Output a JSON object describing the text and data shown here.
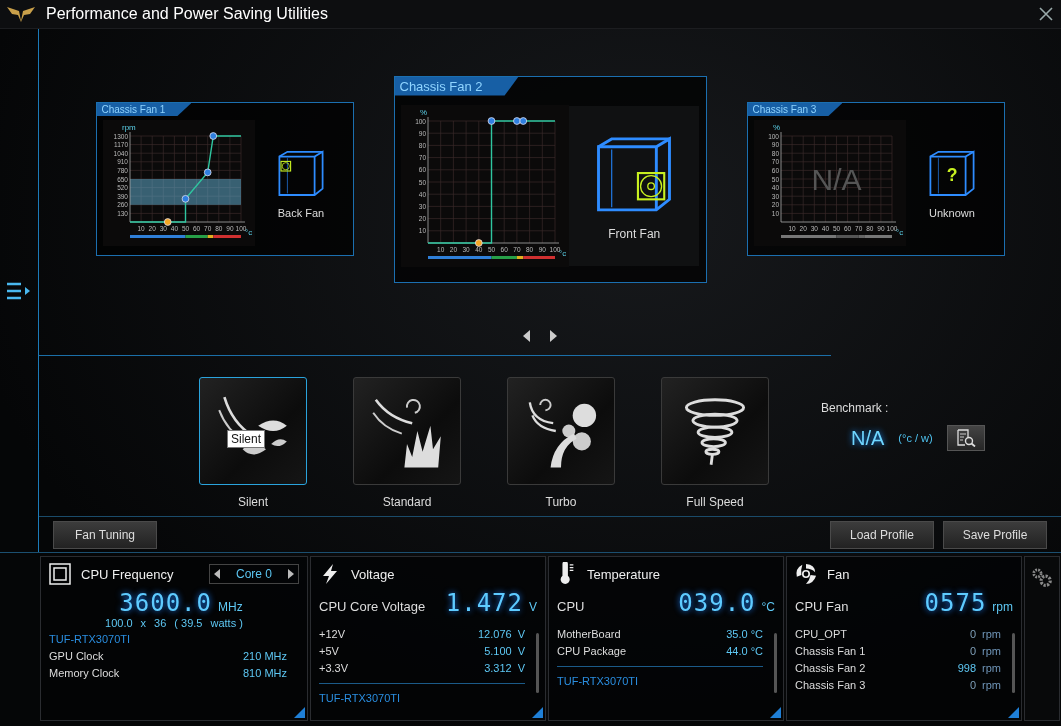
{
  "window": {
    "title": "Performance and Power Saving Utilities"
  },
  "fan_cards": [
    {
      "title": "Chassis Fan 1",
      "selected": false,
      "kind": "back",
      "label": "Back Fan",
      "chart_data": {
        "type": "line",
        "ylabel": "rpm",
        "xlabel": "°c",
        "grid": true,
        "xlim": [
          0,
          100
        ],
        "ylim": [
          0,
          1300
        ],
        "xticks": [
          10,
          20,
          30,
          40,
          50,
          60,
          70,
          80,
          90,
          100
        ],
        "yticks": [
          130,
          260,
          390,
          520,
          650,
          780,
          910,
          1040,
          1170,
          1300
        ],
        "x": [
          0,
          34,
          50,
          50,
          70,
          75,
          100
        ],
        "bands": [
          {
            "axis": "y",
            "from": 260,
            "to": 650
          }
        ],
        "series": [
          {
            "color": "#2fc6a0",
            "values": [
              0,
              0,
              0,
              350,
              750,
              1300,
              1300
            ]
          },
          {
            "type": "scatter",
            "color": "#f5a623",
            "values": [
              null,
              0,
              null,
              null,
              null,
              null,
              null
            ]
          },
          {
            "type": "scatter",
            "color": "#2f7fe0",
            "values": [
              null,
              null,
              null,
              350,
              750,
              1300,
              null
            ]
          }
        ]
      }
    },
    {
      "title": "Chassis Fan 2",
      "selected": true,
      "kind": "front",
      "label": "Front Fan",
      "chart_data": {
        "type": "line",
        "ylabel": "%",
        "xlabel": "°c",
        "grid": true,
        "xlim": [
          0,
          100
        ],
        "ylim": [
          0,
          100
        ],
        "xticks": [
          10,
          20,
          30,
          40,
          50,
          60,
          70,
          80,
          90,
          100
        ],
        "yticks": [
          10,
          20,
          30,
          40,
          50,
          60,
          70,
          80,
          90,
          100
        ],
        "x": [
          0,
          40,
          50,
          50,
          70,
          75,
          100
        ],
        "series": [
          {
            "color": "#2fc6a0",
            "values": [
              0,
              0,
              0,
              100,
              100,
              100,
              100
            ]
          },
          {
            "type": "scatter",
            "color": "#f5a623",
            "values": [
              null,
              0,
              null,
              null,
              null,
              null,
              null
            ]
          },
          {
            "type": "scatter",
            "color": "#2f7fe0",
            "values": [
              null,
              null,
              null,
              100,
              100,
              100,
              null
            ]
          }
        ]
      }
    },
    {
      "title": "Chassis Fan 3",
      "selected": false,
      "kind": "unknown",
      "case_mark": "?",
      "overlay_text": "N/A",
      "label": "Unknown",
      "chart_data": {
        "type": "line",
        "ylabel": "%",
        "xlabel": "°c",
        "grid": true,
        "xlim": [
          0,
          100
        ],
        "ylim": [
          0,
          100
        ],
        "xticks": [
          10,
          20,
          30,
          40,
          50,
          60,
          70,
          80,
          90,
          100
        ],
        "yticks": [
          10,
          20,
          30,
          40,
          50,
          60,
          70,
          80,
          90,
          100
        ]
      }
    }
  ],
  "modes": [
    {
      "label": "Silent",
      "selected": true,
      "kind": "silent"
    },
    {
      "label": "Standard",
      "selected": false,
      "kind": "standard"
    },
    {
      "label": "Turbo",
      "selected": false,
      "kind": "turbo"
    },
    {
      "label": "Full Speed",
      "selected": false,
      "kind": "full"
    }
  ],
  "tooltip": {
    "text": "Silent"
  },
  "benchmark": {
    "label": "Benchmark :",
    "value": "N/A",
    "unit": "(°c / w)"
  },
  "action_buttons": [
    {
      "label": "Fan Tuning",
      "kind": "left"
    },
    {
      "label": "Load Profile",
      "kind": "right"
    },
    {
      "label": "Save Profile",
      "kind": "right"
    }
  ],
  "panels": [
    {
      "kind": "cpu_frequency",
      "title": "CPU Frequency",
      "selector": "Core 0",
      "main": {
        "value": "3600.0",
        "unit": "MHz"
      },
      "sub_texts": [
        "100.0",
        "x",
        "36",
        "( 39.5",
        "watts )"
      ],
      "sections": [
        {
          "heading": "TUF-RTX3070TI",
          "rows": [
            {
              "label": "GPU Clock",
              "value": "210 MHz"
            },
            {
              "label": "Memory Clock",
              "value": "810 MHz"
            }
          ]
        }
      ]
    },
    {
      "kind": "voltage",
      "title": "Voltage",
      "main": {
        "label": "CPU Core Voltage",
        "value": "1.472",
        "unit": "V"
      },
      "sections": [
        {
          "rows": [
            {
              "label": "+12V",
              "value": "12.076",
              "unit": "V"
            },
            {
              "label": "+5V",
              "value": "5.100",
              "unit": "V"
            },
            {
              "label": "+3.3V",
              "value": "3.312",
              "unit": "V"
            }
          ]
        },
        {
          "heading": "TUF-RTX3070TI"
        }
      ]
    },
    {
      "kind": "temperature",
      "title": "Temperature",
      "main": {
        "label": "CPU",
        "value": "039.0",
        "unit": "°C"
      },
      "sections": [
        {
          "rows": [
            {
              "label": "MotherBoard",
              "value": "35.0 °C"
            },
            {
              "label": "CPU Package",
              "value": "44.0 °C"
            }
          ]
        },
        {
          "heading": "TUF-RTX3070TI"
        }
      ]
    },
    {
      "kind": "fan",
      "title": "Fan",
      "main": {
        "label": "CPU Fan",
        "value": "0575",
        "unit": "rpm"
      },
      "sections": [
        {
          "rows": [
            {
              "label": "CPU_OPT",
              "value": "0",
              "unit": "rpm",
              "active": false
            },
            {
              "label": "Chassis Fan 1",
              "value": "0",
              "unit": "rpm",
              "active": false
            },
            {
              "label": "Chassis Fan 2",
              "value": "998",
              "unit": "rpm",
              "active": true
            },
            {
              "label": "Chassis Fan 3",
              "value": "0",
              "unit": "rpm",
              "active": false
            }
          ]
        }
      ]
    }
  ]
}
